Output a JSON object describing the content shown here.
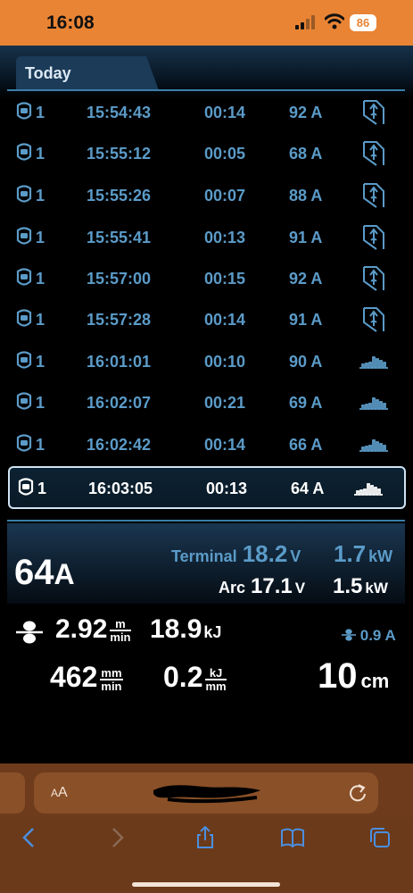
{
  "status_bar": {
    "time": "16:08",
    "battery": "86"
  },
  "tab": {
    "label": "Today"
  },
  "rows": [
    {
      "num": "1",
      "time": "15:54:43",
      "duration": "00:14",
      "current": "92 A",
      "mode": "tiltscrew-icon"
    },
    {
      "num": "1",
      "time": "15:55:12",
      "duration": "00:05",
      "current": "68 A",
      "mode": "tiltscrew-icon"
    },
    {
      "num": "1",
      "time": "15:55:26",
      "duration": "00:07",
      "current": "88 A",
      "mode": "tiltscrew-icon"
    },
    {
      "num": "1",
      "time": "15:55:41",
      "duration": "00:13",
      "current": "91 A",
      "mode": "tiltscrew-icon"
    },
    {
      "num": "1",
      "time": "15:57:00",
      "duration": "00:15",
      "current": "92 A",
      "mode": "tiltscrew-icon"
    },
    {
      "num": "1",
      "time": "15:57:28",
      "duration": "00:14",
      "current": "91 A",
      "mode": "tiltscrew-icon"
    },
    {
      "num": "1",
      "time": "16:01:01",
      "duration": "00:10",
      "current": "90 A",
      "mode": "pulse-icon"
    },
    {
      "num": "1",
      "time": "16:02:07",
      "duration": "00:21",
      "current": "69 A",
      "mode": "pulse-icon"
    },
    {
      "num": "1",
      "time": "16:02:42",
      "duration": "00:14",
      "current": "66 A",
      "mode": "pulse-icon"
    },
    {
      "num": "1",
      "time": "16:03:05",
      "duration": "00:13",
      "current": "64 A",
      "mode": "pulse-icon",
      "selected": true
    }
  ],
  "detail": {
    "current_value": "64",
    "current_unit": "A",
    "terminal_label": "Terminal",
    "terminal_voltage": "18.2",
    "terminal_voltage_unit": "V",
    "terminal_power": "1.7",
    "terminal_power_unit": "kW",
    "arc_label": "Arc",
    "arc_voltage": "17.1",
    "arc_voltage_unit": "V",
    "arc_power": "1.5",
    "arc_power_unit": "kW",
    "wire_speed": "2.92",
    "wire_speed_unit_num": "m",
    "wire_speed_unit_den": "min",
    "energy": "18.9",
    "energy_unit": "kJ",
    "gas_flow": "0.9 A",
    "travel_speed": "462",
    "travel_speed_unit_num": "mm",
    "travel_speed_unit_den": "min",
    "heat_input": "0.2",
    "heat_input_unit_num": "kJ",
    "heat_input_unit_den": "mm",
    "length": "10",
    "length_unit": "cm"
  },
  "browser": {
    "text_size_label_small": "A",
    "text_size_label_big": "A"
  },
  "colors": {
    "status_bar": "#e98434",
    "accent_blue": "#5b9bc8",
    "browser_bg": "#6b3a1a"
  }
}
